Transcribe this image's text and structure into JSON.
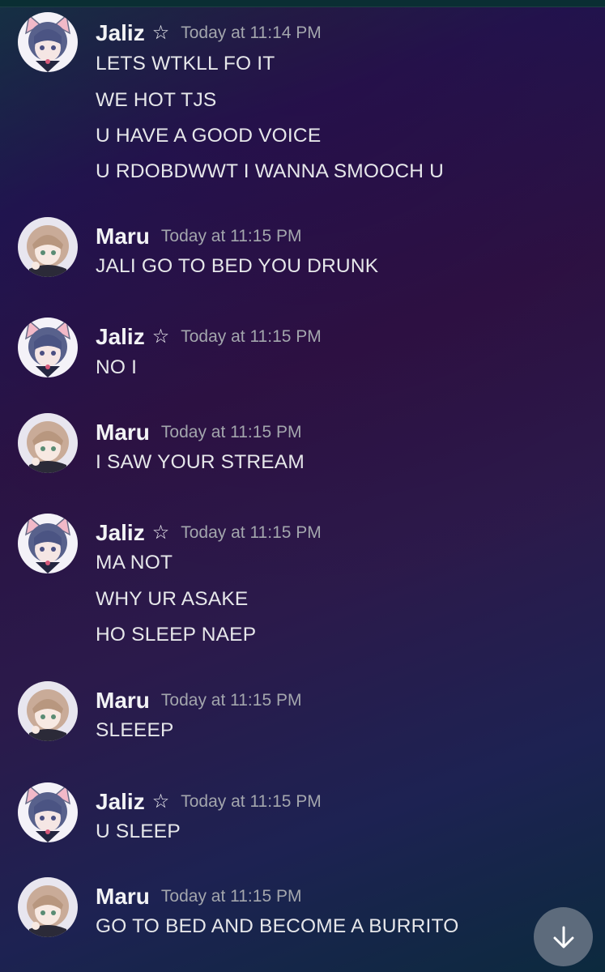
{
  "users": {
    "jaliz": {
      "name": "Jaliz",
      "badge": "☆",
      "badge_icon": "star-outline-icon"
    },
    "maru": {
      "name": "Maru"
    }
  },
  "groups": [
    {
      "author": "jaliz",
      "time": "Today at 11:14 PM",
      "lines": [
        "LETS WTKLL FO IT",
        "WE HOT TJS",
        "U HAVE A GOOD VOICE",
        "U RDOBDWWT I WANNA SMOOCH U"
      ]
    },
    {
      "author": "maru",
      "time": "Today at 11:15 PM",
      "lines": [
        "JALI GO TO BED YOU DRUNK"
      ]
    },
    {
      "author": "jaliz",
      "time": "Today at 11:15 PM",
      "lines": [
        "NO I"
      ]
    },
    {
      "author": "maru",
      "time": "Today at 11:15 PM",
      "lines": [
        "I SAW YOUR STREAM"
      ]
    },
    {
      "author": "jaliz",
      "time": "Today at 11:15 PM",
      "lines": [
        "MA NOT",
        "WHY UR ASAKE",
        "HO SLEEP NAEP"
      ]
    },
    {
      "author": "maru",
      "time": "Today at 11:15 PM",
      "lines": [
        "SLEEEP"
      ]
    },
    {
      "author": "jaliz",
      "time": "Today at 11:15 PM",
      "lines": [
        "U SLEEP"
      ]
    },
    {
      "author": "maru",
      "time": "Today at 11:15 PM",
      "lines": [
        "GO TO BED AND BECOME A BURRITO"
      ]
    }
  ],
  "scroll_button": {
    "icon": "arrow-down-icon"
  },
  "colors": {
    "username": "#f2f3f5",
    "timestamp": "#a3a6ad",
    "message": "#e6e7ea",
    "scroll_button_bg": "#5d6b7c"
  }
}
